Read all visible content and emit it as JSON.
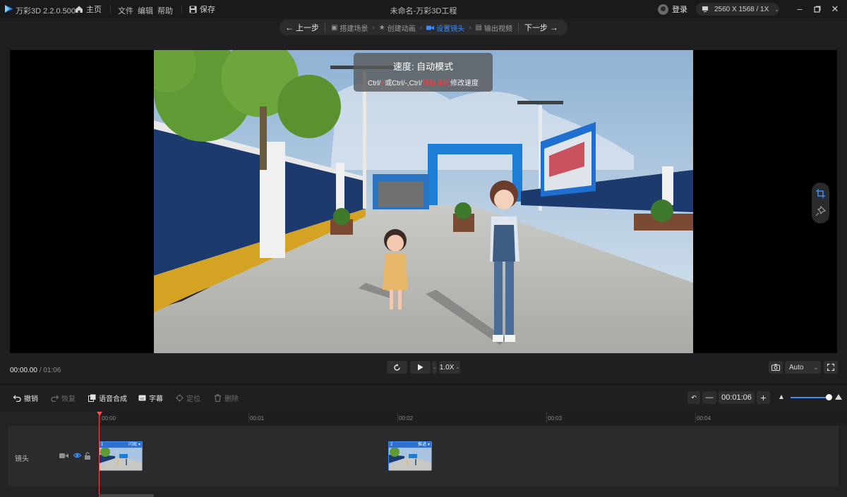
{
  "app": {
    "name": "万彩3D 2.2.0.500",
    "project_title": "未命名-万彩3D工程"
  },
  "titlebar": {
    "home": "主页",
    "menus": [
      "文件",
      "编辑",
      "帮助"
    ],
    "save": "保存",
    "login": "登录",
    "resolution": "2560 X 1568 / 1X"
  },
  "steps": {
    "prev": "上一步",
    "items": [
      "搭建场景",
      "创建动画",
      "设置镜头",
      "输出视频"
    ],
    "active_index": 2,
    "next": "下一步"
  },
  "speed_tip": {
    "title": "速度: 自动模式",
    "line_parts": [
      "Ctrl/",
      "+",
      "或Ctrl/",
      "-",
      ",Ctrl/",
      "鼠标滚轮",
      "修改速度"
    ]
  },
  "playback": {
    "current": "00:00.00",
    "total": "/ 01:06",
    "speed": "1.0X",
    "quality": "Auto"
  },
  "toolbar": {
    "undo": "撤销",
    "redo": "恢复",
    "tts": "语音合成",
    "subtitle": "字幕",
    "locate": "定位",
    "delete": "删除",
    "duration": "00:01:06"
  },
  "timeline": {
    "ticks": [
      "00:00",
      "00:01",
      "00:02",
      "00:03",
      "00:04"
    ],
    "track_label": "镜头",
    "clips": [
      {
        "num": "1",
        "name": "闪现"
      },
      {
        "num": "2",
        "name": "推进"
      }
    ]
  },
  "colors": {
    "accent": "#3d8cf2",
    "playhead": "#ff4d4d",
    "warn": "#ff3b3b"
  }
}
